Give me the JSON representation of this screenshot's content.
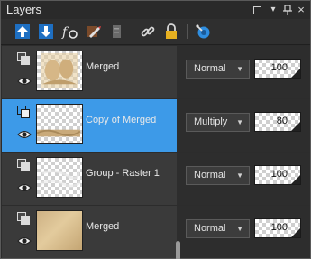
{
  "panel": {
    "title": "Layers",
    "controls": [
      "restore-icon",
      "dropdown-icon",
      "pin-icon",
      "close-icon"
    ]
  },
  "toolbar": {
    "tools": [
      "new-layer-up-icon",
      "new-layer-down-icon",
      "layer-effects-icon",
      "edit-layer-icon",
      "delete-layer-icon",
      "link-icon",
      "lock-icon",
      "layer-blend-icon"
    ]
  },
  "layers": [
    {
      "name": "Merged",
      "blend_mode": "Normal",
      "opacity": "100",
      "selected": false,
      "thumbnail": "portrait-on-transparent"
    },
    {
      "name": "Copy of Merged",
      "blend_mode": "Multiply",
      "opacity": "80",
      "selected": true,
      "thumbnail": "strip-on-transparent"
    },
    {
      "name": "Group - Raster 1",
      "blend_mode": "Normal",
      "opacity": "100",
      "selected": false,
      "thumbnail": "faint-pattern-on-transparent"
    },
    {
      "name": "Merged",
      "blend_mode": "Normal",
      "opacity": "100",
      "selected": false,
      "thumbnail": "beige-gradient"
    }
  ],
  "colors": {
    "selection": "#3d9ae8",
    "row_background": "#3a3a3a",
    "panel_background": "#2c2c2c"
  }
}
